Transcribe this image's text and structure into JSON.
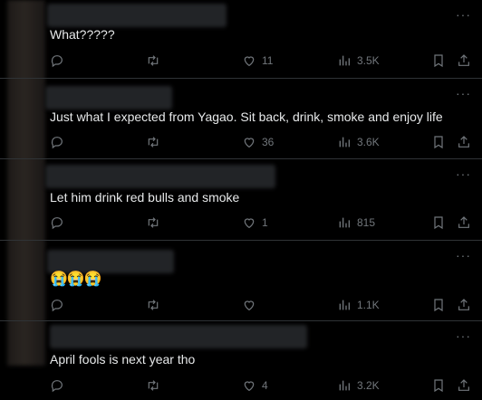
{
  "tweets": [
    {
      "text": "What?????",
      "replies": "",
      "retweets": "",
      "likes": "11",
      "views": "3.5K"
    },
    {
      "text": "Just what I expected from Yagao. Sit back, drink, smoke and enjoy life",
      "replies": "",
      "retweets": "",
      "likes": "36",
      "views": "3.6K"
    },
    {
      "text": "Let him drink red bulls and smoke",
      "replies": "",
      "retweets": "",
      "likes": "1",
      "views": "815"
    },
    {
      "text": "😭😭😭",
      "replies": "",
      "retweets": "",
      "likes": "",
      "views": "1.1K"
    },
    {
      "text": "April fools is next year tho",
      "replies": "",
      "retweets": "",
      "likes": "4",
      "views": "3.2K"
    }
  ],
  "more_label": "···",
  "icons": [
    "reply-icon",
    "retweet-icon",
    "like-icon",
    "views-icon",
    "bookmark-icon",
    "share-icon"
  ],
  "colors": {
    "background": "#000000",
    "text": "#e7e9ea",
    "muted": "#71767b",
    "divider": "#2f3336"
  }
}
